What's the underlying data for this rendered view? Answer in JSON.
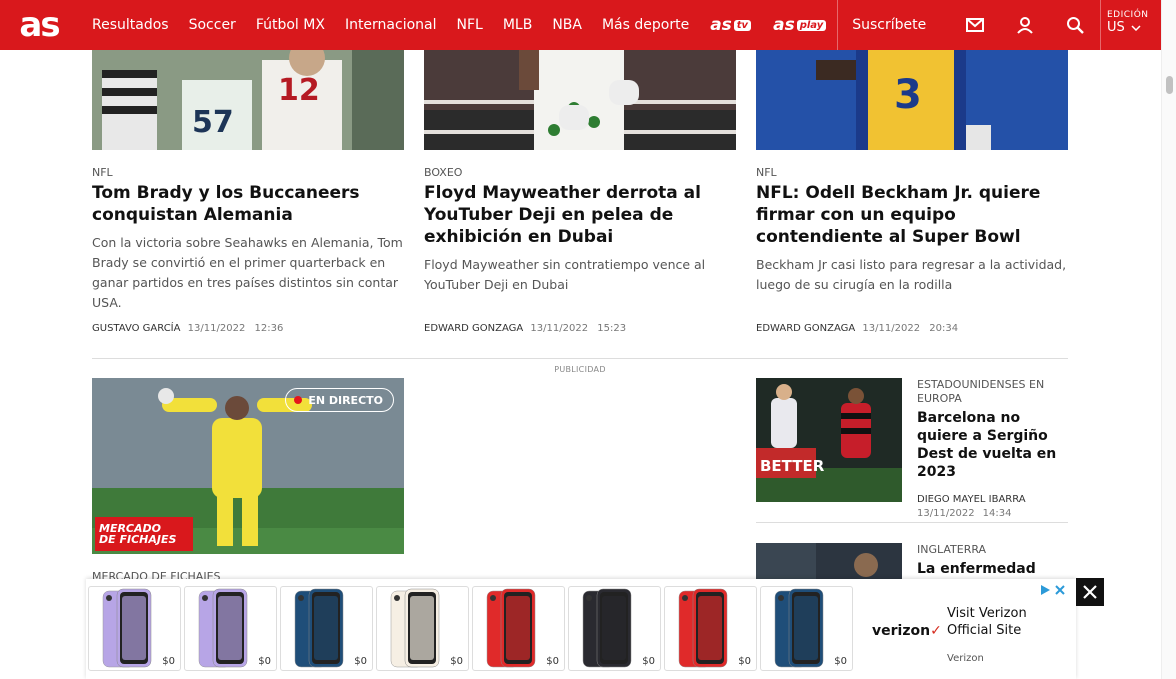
{
  "nav": {
    "logo": "as",
    "links": [
      "Resultados",
      "Soccer",
      "Fútbol MX",
      "Internacional",
      "NFL",
      "MLB",
      "NBA",
      "Más deporte"
    ],
    "brand_tv": "as",
    "brand_tv_suffix": "tv",
    "brand_play": "as",
    "brand_play_suffix": "play",
    "subscribe": "Suscríbete",
    "edition_label": "EDICIÓN",
    "edition_value": "US"
  },
  "top_articles": [
    {
      "kicker": "NFL",
      "title": "Tom Brady y los Buccaneers conquistan Alemania",
      "summary": "Con la victoria sobre Seahawks en Alemania, Tom Brady se convirtió en el primer quarterback en ganar partidos en tres países distintos sin contar USA.",
      "author": "GUSTAVO GARCÍA",
      "date": "13/11/2022",
      "time": "12:36"
    },
    {
      "kicker": "BOXEO",
      "title": "Floyd Mayweather derrota al YouTuber Deji en pelea de exhibición en Dubai",
      "summary": "Floyd Mayweather sin contratiempo vence al YouTuber Deji en Dubai",
      "author": "EDWARD GONZAGA",
      "date": "13/11/2022",
      "time": "15:23"
    },
    {
      "kicker": "NFL",
      "title": "NFL: Odell Beckham Jr. quiere firmar con un equipo contendiente al Super Bowl",
      "summary": "Beckham Jr casi listo para regresar a la actividad, luego de su cirugía en la rodilla",
      "author": "EDWARD GONZAGA",
      "date": "13/11/2022",
      "time": "20:34"
    }
  ],
  "feature": {
    "live_label": "EN DIRECTO",
    "badge_line1": "MERCADO",
    "badge_line2": "DE FICHAJES",
    "kicker": "MERCADO DE FICHAJES"
  },
  "ad_label": "PUBLICIDAD",
  "side_articles": [
    {
      "kicker": "ESTADOUNIDENSES EN EUROPA",
      "title": "Barcelona no quiere a Sergiño Dest de vuelta en 2023",
      "author": "DIEGO MAYEL IBARRA",
      "date": "13/11/2022",
      "time": "14:34"
    },
    {
      "kicker": "INGLATERRA",
      "title": "La enfermedad que"
    }
  ],
  "ad": {
    "phones": [
      {
        "color": "#b7a5e6",
        "price": "$0"
      },
      {
        "color": "#b7a5e6",
        "price": "$0"
      },
      {
        "color": "#1f4e79",
        "price": "$0"
      },
      {
        "color": "#f6efe4",
        "price": "$0"
      },
      {
        "color": "#e02a2a",
        "price": "$0"
      },
      {
        "color": "#2a2a30",
        "price": "$0"
      },
      {
        "color": "#e02a2a",
        "price": "$0"
      },
      {
        "color": "#1f4e79",
        "price": "$0"
      }
    ],
    "logo": "verizon",
    "logo_mark": "✓",
    "cta": "Visit Verizon Official Site",
    "brand": "Verizon"
  },
  "colors": {
    "brand_red": "#d9181c"
  }
}
